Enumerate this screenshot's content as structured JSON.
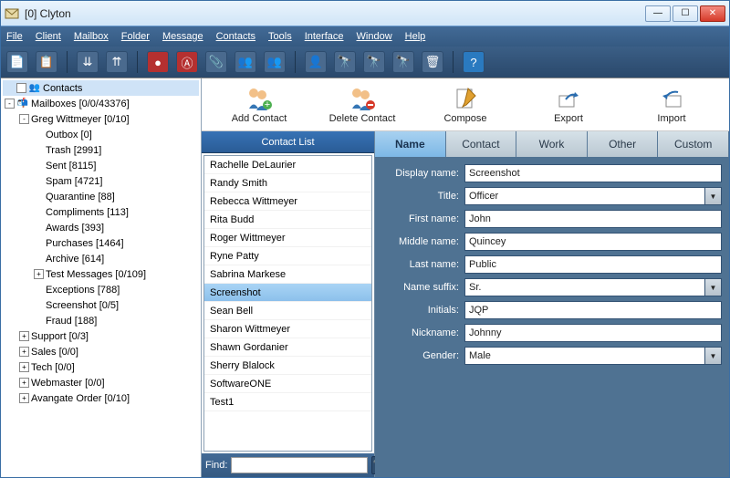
{
  "window": {
    "title": "[0] Clyton"
  },
  "menubar": [
    "File",
    "Client",
    "Mailbox",
    "Folder",
    "Message",
    "Contacts",
    "Tools",
    "Interface",
    "Window",
    "Help"
  ],
  "tree": [
    {
      "level": 0,
      "exp": "",
      "chk": true,
      "icon": "👥",
      "label": "Contacts",
      "selected": true
    },
    {
      "level": 0,
      "exp": "-",
      "icon": "📬",
      "label": "Mailboxes [0/0/43376]"
    },
    {
      "level": 1,
      "exp": "-",
      "icon": "",
      "label": "Greg Wittmeyer [0/10]"
    },
    {
      "level": 2,
      "exp": "",
      "icon": "",
      "label": "Outbox [0]"
    },
    {
      "level": 2,
      "exp": "",
      "icon": "",
      "label": "Trash [2991]"
    },
    {
      "level": 2,
      "exp": "",
      "icon": "",
      "label": "Sent [8115]"
    },
    {
      "level": 2,
      "exp": "",
      "icon": "",
      "label": "Spam [4721]"
    },
    {
      "level": 2,
      "exp": "",
      "icon": "",
      "label": "Quarantine [88]"
    },
    {
      "level": 2,
      "exp": "",
      "icon": "",
      "label": "Compliments [113]"
    },
    {
      "level": 2,
      "exp": "",
      "icon": "",
      "label": "Awards [393]"
    },
    {
      "level": 2,
      "exp": "",
      "icon": "",
      "label": "Purchases [1464]"
    },
    {
      "level": 2,
      "exp": "",
      "icon": "",
      "label": "Archive [614]"
    },
    {
      "level": 2,
      "exp": "+",
      "icon": "",
      "label": "Test Messages [0/109]"
    },
    {
      "level": 2,
      "exp": "",
      "icon": "",
      "label": "Exceptions [788]"
    },
    {
      "level": 2,
      "exp": "",
      "icon": "",
      "label": "Screenshot [0/5]"
    },
    {
      "level": 2,
      "exp": "",
      "icon": "",
      "label": "Fraud [188]"
    },
    {
      "level": 1,
      "exp": "+",
      "icon": "",
      "label": "Support [0/3]"
    },
    {
      "level": 1,
      "exp": "+",
      "icon": "",
      "label": "Sales [0/0]"
    },
    {
      "level": 1,
      "exp": "+",
      "icon": "",
      "label": "Tech [0/0]"
    },
    {
      "level": 1,
      "exp": "+",
      "icon": "",
      "label": "Webmaster [0/0]"
    },
    {
      "level": 1,
      "exp": "+",
      "icon": "",
      "label": "Avangate Order [0/10]"
    }
  ],
  "actions": [
    {
      "label": "Add Contact",
      "name": "add-contact-button",
      "icon": "add-contact-icon"
    },
    {
      "label": "Delete Contact",
      "name": "delete-contact-button",
      "icon": "delete-contact-icon"
    },
    {
      "label": "Compose",
      "name": "compose-button",
      "icon": "compose-icon"
    },
    {
      "label": "Export",
      "name": "export-button",
      "icon": "export-icon"
    },
    {
      "label": "Import",
      "name": "import-button",
      "icon": "import-icon"
    }
  ],
  "contactList": {
    "header": "Contact List",
    "items": [
      "Rachelle DeLaurier",
      "Randy Smith",
      "Rebecca Wittmeyer",
      "Rita Budd",
      "Roger Wittmeyer",
      "Ryne Patty",
      "Sabrina Markese",
      "Screenshot",
      "Sean Bell",
      "Sharon Wittmeyer",
      "Shawn Gordanier",
      "Sherry Blalock",
      "SoftwareONE",
      "Test1"
    ],
    "selectedIndex": 7,
    "findLabel": "Find:",
    "findValue": ""
  },
  "tabs": [
    "Name",
    "Contact",
    "Work",
    "Other",
    "Custom"
  ],
  "activeTab": 0,
  "fields": [
    {
      "label": "Display name:",
      "value": "Screenshot",
      "type": "text",
      "name": "display-name-field"
    },
    {
      "label": "Title:",
      "value": "Officer",
      "type": "select",
      "name": "title-field"
    },
    {
      "label": "First name:",
      "value": "John",
      "type": "text",
      "name": "first-name-field"
    },
    {
      "label": "Middle name:",
      "value": "Quincey",
      "type": "text",
      "name": "middle-name-field"
    },
    {
      "label": "Last name:",
      "value": "Public",
      "type": "text",
      "name": "last-name-field"
    },
    {
      "label": "Name suffix:",
      "value": "Sr.",
      "type": "select",
      "name": "name-suffix-field"
    },
    {
      "label": "Initials:",
      "value": "JQP",
      "type": "text",
      "name": "initials-field"
    },
    {
      "label": "Nickname:",
      "value": "Johnny",
      "type": "text",
      "name": "nickname-field"
    },
    {
      "label": "Gender:",
      "value": "Male",
      "type": "select",
      "name": "gender-field"
    }
  ],
  "colors": {
    "accent": "#3a6ea5",
    "menubar": "#3c6189",
    "detailBg": "#4f7292"
  }
}
